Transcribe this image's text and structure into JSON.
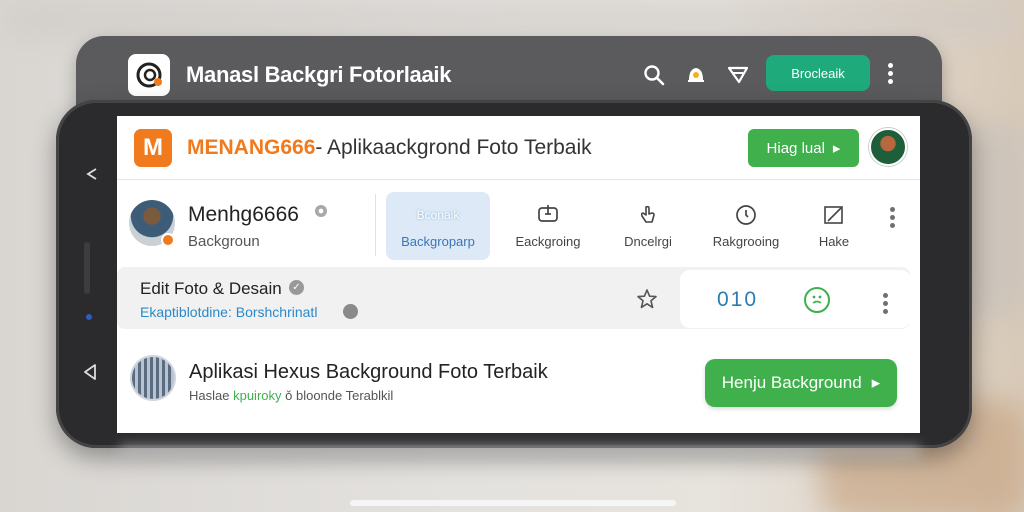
{
  "topbar": {
    "title": "Manasl Backgri  Fotorlaaik",
    "pill_label": "Brocleaik",
    "icons": [
      "search-icon",
      "bell-icon",
      "filter-icon"
    ]
  },
  "header": {
    "logo_letter": "M",
    "brand_accent": "MENANG666",
    "brand_rest": "- Aplikaackgrond Foto Terbaik",
    "button_label": "Hiag lual",
    "button_arrow": "▸"
  },
  "profile": {
    "name": "Menhg6666",
    "subtitle": "Backgroun",
    "tabs": [
      {
        "icon_label": "Bconaik",
        "label": "Backgroparp",
        "active": true
      },
      {
        "icon": "crop-icon",
        "label": "Eackgroing",
        "active": false
      },
      {
        "icon": "hand-icon",
        "label": "Dncelrgi",
        "active": false
      },
      {
        "icon": "clock-icon",
        "label": "Rakgrooing",
        "active": false
      },
      {
        "icon": "edit-icon",
        "label": "Hake",
        "active": false
      }
    ]
  },
  "edit": {
    "title": "Edit Foto & Desain",
    "link": "Ekaptiblotdine: Borshchrinatl",
    "count": "010"
  },
  "listing": {
    "title": "Aplikasi Hexus Background Foto Terbaik",
    "sub_prefix": "Haslae",
    "sub_green": "kpuiroky",
    "sub_rest": "ǒ bloonde Terablkil",
    "button_label": "Henju Background",
    "button_arrow": "▸"
  },
  "colors": {
    "accent_orange": "#f07a1c",
    "accent_green": "#3fb04c",
    "teal": "#1faa7c",
    "link_blue": "#2a8ac9"
  }
}
